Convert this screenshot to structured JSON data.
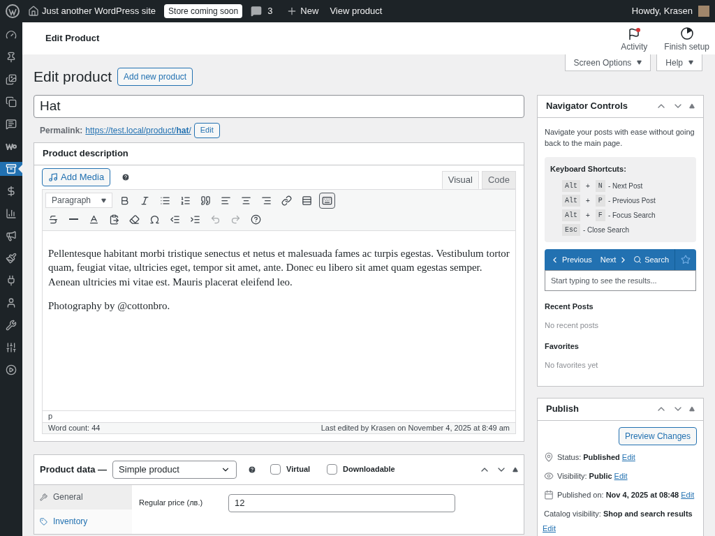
{
  "admin_bar": {
    "site_name": "Just another WordPress site",
    "badge": "Store coming soon",
    "comments": "3",
    "new": "New",
    "view": "View product",
    "howdy": "Howdy, Krasen"
  },
  "sidebar": {
    "items": [
      {
        "kind": "dashboard",
        "selected": false
      },
      {
        "kind": "pin",
        "selected": false
      },
      {
        "kind": "media",
        "selected": false
      },
      {
        "kind": "pages",
        "selected": false
      },
      {
        "kind": "comments",
        "selected": false
      },
      {
        "kind": "woo",
        "selected": false
      },
      {
        "kind": "products",
        "selected": true
      },
      {
        "kind": "payments",
        "selected": false
      },
      {
        "kind": "analytics",
        "selected": false
      },
      {
        "kind": "marketing",
        "selected": false
      },
      {
        "kind": "appearance",
        "selected": false
      },
      {
        "kind": "plugins",
        "selected": false
      },
      {
        "kind": "users",
        "selected": false
      },
      {
        "kind": "tools",
        "selected": false
      },
      {
        "kind": "settings",
        "selected": false
      },
      {
        "kind": "play",
        "selected": false
      }
    ]
  },
  "header": {
    "title": "Edit Product",
    "activity": "Activity",
    "activity_unread": true,
    "finish_setup": "Finish setup"
  },
  "screen_tabs": [
    "Screen Options",
    "Help"
  ],
  "page": {
    "title": "Edit product",
    "add_new": "Add new product"
  },
  "post_title": "Hat",
  "permalink": {
    "label": "Permalink:",
    "url": "https://test.local/product/**hat**/",
    "edit": "Edit"
  },
  "description": {
    "title": "Product description",
    "add_media": "Add Media",
    "tabs": [
      {
        "label": "Visual",
        "selected": true
      },
      {
        "label": "Code",
        "selected": false
      }
    ],
    "format": "Paragraph",
    "toolbar": [
      [
        {
          "kind": "bold",
          "pressed": false,
          "disabled": false
        },
        {
          "kind": "italic",
          "pressed": false,
          "disabled": false
        },
        {
          "kind": "bullets",
          "pressed": false,
          "disabled": false
        },
        {
          "kind": "numbers",
          "pressed": false,
          "disabled": false
        },
        {
          "kind": "quote",
          "pressed": false,
          "disabled": false
        },
        {
          "kind": "align-left",
          "pressed": false,
          "disabled": false
        },
        {
          "kind": "align-center",
          "pressed": false,
          "disabled": false
        },
        {
          "kind": "align-right",
          "pressed": false,
          "disabled": false
        },
        {
          "kind": "link",
          "pressed": false,
          "disabled": false
        },
        {
          "kind": "more",
          "pressed": false,
          "disabled": false
        },
        {
          "kind": "toolbar-toggle",
          "pressed": true,
          "disabled": false
        }
      ],
      [
        {
          "kind": "strike",
          "pressed": false,
          "disabled": false
        },
        {
          "kind": "hr",
          "pressed": false,
          "disabled": false
        },
        {
          "kind": "text-color",
          "pressed": false,
          "disabled": false
        },
        {
          "kind": "paste",
          "pressed": false,
          "disabled": false
        },
        {
          "kind": "eraser",
          "pressed": false,
          "disabled": false
        },
        {
          "kind": "omega",
          "pressed": false,
          "disabled": false
        },
        {
          "kind": "outdent",
          "pressed": false,
          "disabled": false
        },
        {
          "kind": "indent",
          "pressed": false,
          "disabled": false
        },
        {
          "kind": "undo",
          "pressed": false,
          "disabled": true
        },
        {
          "kind": "redo",
          "pressed": false,
          "disabled": true
        },
        {
          "kind": "help",
          "pressed": false,
          "disabled": false
        }
      ]
    ],
    "paragraphs": [
      "Pellentesque habitant morbi tristique senectus et netus et malesuada fames ac turpis egestas. Vestibulum tortor quam, feugiat vitae, ultricies eget, tempor sit amet, ante. Donec eu libero sit amet quam egestas semper. Aenean ultricies mi vitae est. Mauris placerat eleifend leo.",
      "Photography by @cottonbro."
    ],
    "path": "p",
    "word_count": "Word count: 44",
    "last_edited": "Last edited by Krasen on November 4, 2025 at 8:49 am"
  },
  "product_data": {
    "title": "Product data —",
    "type": "Simple product",
    "options": [
      {
        "label": "Virtual",
        "checked": false
      },
      {
        "label": "Downloadable",
        "checked": false
      }
    ],
    "tabs": [
      {
        "label": "General",
        "kind": "wrench",
        "selected": true
      },
      {
        "label": "Inventory",
        "kind": "tag",
        "selected": false
      }
    ],
    "fields": [
      {
        "label": "Regular price (лв.)",
        "value": "12"
      }
    ]
  },
  "navigator": {
    "title": "Navigator Controls",
    "intro": "Navigate your posts with ease without going back to the main page.",
    "shortcuts_title": "Keyboard Shortcuts:",
    "shortcuts": [
      {
        "keys": [
          "Alt",
          "N"
        ],
        "action": "- Next Post"
      },
      {
        "keys": [
          "Alt",
          "P"
        ],
        "action": "- Previous Post"
      },
      {
        "keys": [
          "Alt",
          "F"
        ],
        "action": "- Focus Search"
      },
      {
        "keys": [
          "Esc"
        ],
        "action": "- Close Search"
      }
    ],
    "plus": "+",
    "previous": "Previous",
    "next": "Next",
    "search": "Search",
    "search_placeholder": "Start typing to see the results...",
    "sections": [
      {
        "title": "Recent Posts",
        "empty": "No recent posts"
      },
      {
        "title": "Favorites",
        "empty": "No favorites yet"
      }
    ]
  },
  "publish": {
    "title": "Publish",
    "preview": "Preview Changes",
    "rows": [
      {
        "kind": "pin",
        "label": "Status:",
        "value": "Published",
        "edit": "Edit"
      },
      {
        "kind": "eye",
        "label": "Visibility:",
        "value": "Public",
        "edit": "Edit"
      },
      {
        "kind": "calendar",
        "label": "Published on:",
        "value": "Nov 4, 2025 at 08:48",
        "edit": "Edit"
      },
      {
        "kind": "none",
        "label": "Catalog visibility:",
        "value": "Shop and search results",
        "edit": "Edit"
      }
    ]
  }
}
